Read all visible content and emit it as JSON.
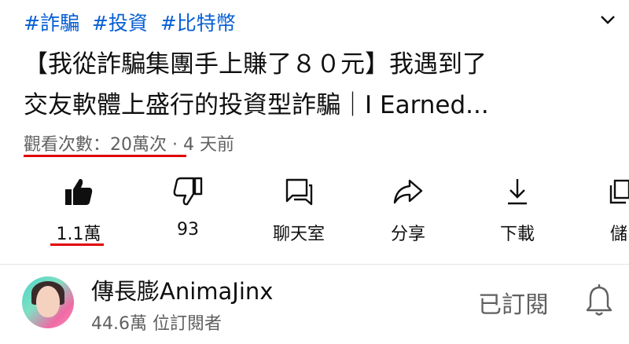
{
  "hashtags": [
    "#詐騙",
    "#投資",
    "#比特幣"
  ],
  "video": {
    "title_line1": "【我從詐騙集團手上賺了８０元】我遇到了",
    "title_line2": "交友軟體上盛行的投資型詐騙｜I Earned...",
    "views": "觀看次數：20萬次",
    "separator": " · ",
    "age": "4 天前"
  },
  "actions": {
    "like": "1.1萬",
    "dislike": "93",
    "chat": "聊天室",
    "share": "分享",
    "download": "下載",
    "save": "儲"
  },
  "channel": {
    "name": "傳長膨AnimaJinx",
    "subscribers": "44.6萬 位訂閱者",
    "subscribed_label": "已訂閱"
  },
  "colors": {
    "hashtag": "#065fd4",
    "highlight": "#e00000",
    "muted": "#606060"
  },
  "icons": [
    "chevron-down-icon",
    "like-icon",
    "dislike-icon",
    "chat-icon",
    "share-icon",
    "download-icon",
    "save-icon",
    "bell-icon"
  ]
}
